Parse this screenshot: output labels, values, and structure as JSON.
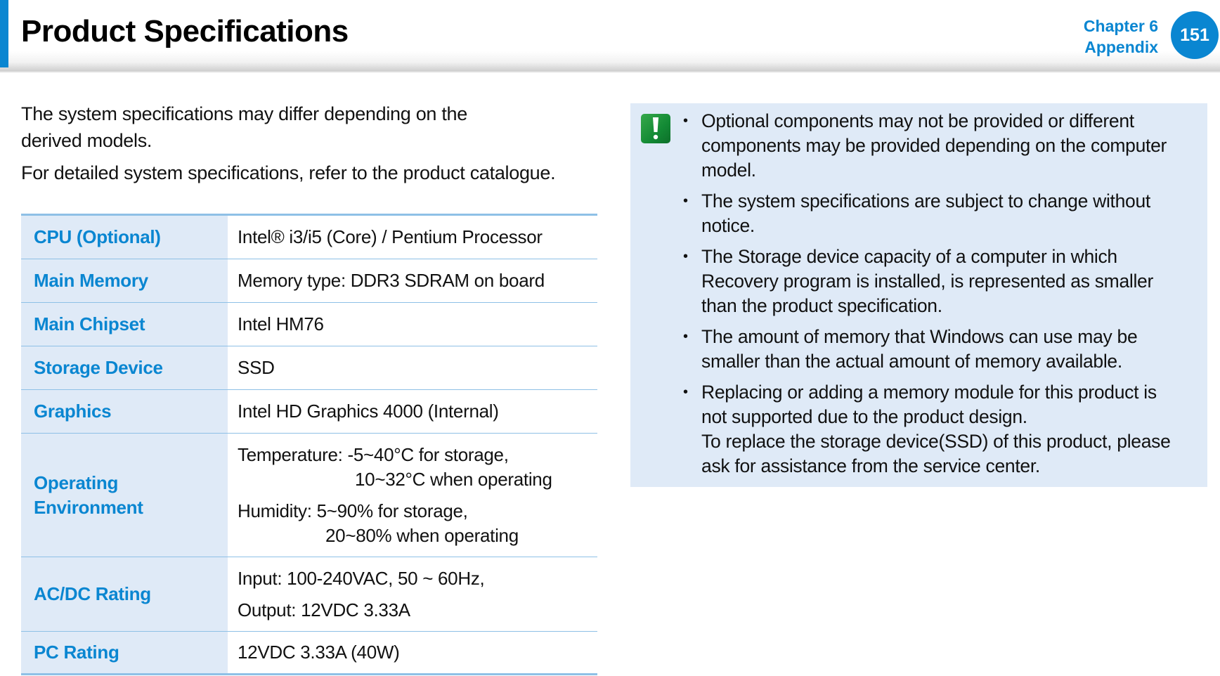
{
  "header": {
    "title": "Product Specifications",
    "chapter": "Chapter 6",
    "section": "Appendix",
    "page_number": "151",
    "accent_color": "#0a86d1"
  },
  "intro": {
    "paragraphs": [
      "The system specifications may differ depending on the derived models.",
      "For detailed system specifications, refer to the product catalogue."
    ]
  },
  "specs": [
    {
      "label": "CPU (Optional)",
      "values": [
        "Intel® i3/i5 (Core) / Pentium Processor"
      ]
    },
    {
      "label": "Main Memory",
      "values": [
        "Memory type: DDR3 SDRAM on board"
      ]
    },
    {
      "label": "Main Chipset",
      "values": [
        "Intel HM76"
      ]
    },
    {
      "label": "Storage Device",
      "values": [
        "SSD"
      ]
    },
    {
      "label": "Graphics",
      "values": [
        "Intel HD Graphics 4000 (Internal)"
      ]
    },
    {
      "label_lines": [
        "Operating",
        "Environment"
      ],
      "values": [
        "Temperature: -5~40°C for storage,",
        "10~32°C when operating",
        "Humidity: 5~90% for storage,",
        "20~80% when operating"
      ]
    },
    {
      "label": "AC/DC Rating",
      "values": [
        "Input: 100-240VAC, 50 ~ 60Hz,",
        "Output: 12VDC 3.33A"
      ]
    },
    {
      "label": "PC Rating",
      "values": [
        "12VDC 3.33A (40W)"
      ]
    }
  ],
  "note": {
    "icon": "warning-exclamation-icon",
    "bullet": "•",
    "items": [
      {
        "lines": [
          "Optional components may not be provided or different",
          "components may be provided depending on the computer",
          "model."
        ]
      },
      {
        "lines": [
          "The system specifications are subject to change without",
          "notice."
        ]
      },
      {
        "lines": [
          "The Storage device capacity of a computer in which",
          "Recovery program is installed, is represented as smaller",
          "than the product specification."
        ]
      },
      {
        "lines": [
          "The amount of memory that Windows can use may be",
          "smaller than the actual amount of memory available."
        ]
      },
      {
        "lines": [
          "Replacing or adding a memory module for this product is",
          "not supported due to the product design.",
          "To replace the storage device(SSD) of this product, please",
          "ask for assistance from the service center."
        ]
      }
    ]
  }
}
